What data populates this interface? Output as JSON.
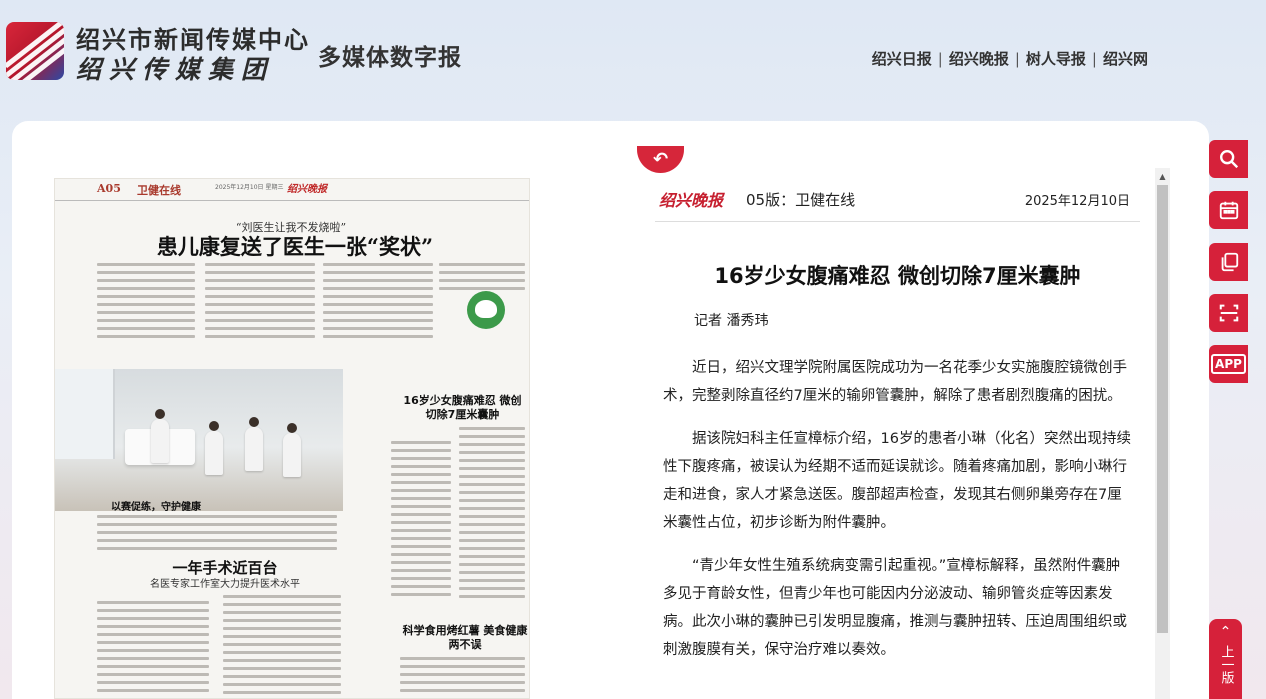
{
  "header": {
    "logo_line1": "绍兴市新闻传媒中心",
    "logo_line2": "绍兴传媒集团",
    "subtitle": "多媒体数字报",
    "nav": [
      "绍兴日报",
      "绍兴晚报",
      "树人导报",
      "绍兴网"
    ],
    "separator": "|"
  },
  "newspaper_page": {
    "page_no": "A05",
    "section": "卫健在线",
    "date": "2025年12月10日 星期三",
    "brand": "绍兴晚报",
    "story1_subtitle": "“刘医生让我不发烧啦”",
    "story1_title": "患儿康复送了医生一张“奖状”",
    "photo_caption": "以赛促练，守护健康",
    "story2_title": "16岁少女腹痛难忍 微创切除7厘米囊肿",
    "story3_title": "一年手术近百台",
    "story3_subtitle": "名医专家工作室大力提升医术水平",
    "story4_title": "科学食用烤红薯 美食健康两不误"
  },
  "article": {
    "back_icon": "return-arrow",
    "brand": "绍兴晚报",
    "section": "05版：卫健在线",
    "date": "2025年12月10日",
    "title": "16岁少女腹痛难忍 微创切除7厘米囊肿",
    "author": "记者 潘秀玮",
    "paragraphs": [
      "近日，绍兴文理学院附属医院成功为一名花季少女实施腹腔镜微创手术，完整剥除直径约7厘米的输卵管囊肿，解除了患者剧烈腹痛的困扰。",
      "据该院妇科主任宣樟标介绍，16岁的患者小琳（化名）突然出现持续性下腹疼痛，被误认为经期不适而延误就诊。随着疼痛加剧，影响小琳行走和进食，家人才紧急送医。腹部超声检查，发现其右侧卵巢旁存在7厘米囊性占位，初步诊断为附件囊肿。",
      "“青少年女性生殖系统病变需引起重视。”宣樟标解释，虽然附件囊肿多见于育龄女性，但青少年也可能因内分泌波动、输卵管炎症等因素发病。此次小琳的囊肿已引发明显腹痛，推测与囊肿扭转、压迫周围组织或刺激腹膜有关，保守治疗难以奏效。"
    ]
  },
  "tools": {
    "icons": [
      "search-icon",
      "calendar-icon",
      "copy-icon",
      "scan-icon",
      "app-icon"
    ],
    "app_label": "APP",
    "prev_label": "上一版"
  },
  "colors": {
    "accent": "#d6213a",
    "brand_red": "#c61f2f"
  }
}
